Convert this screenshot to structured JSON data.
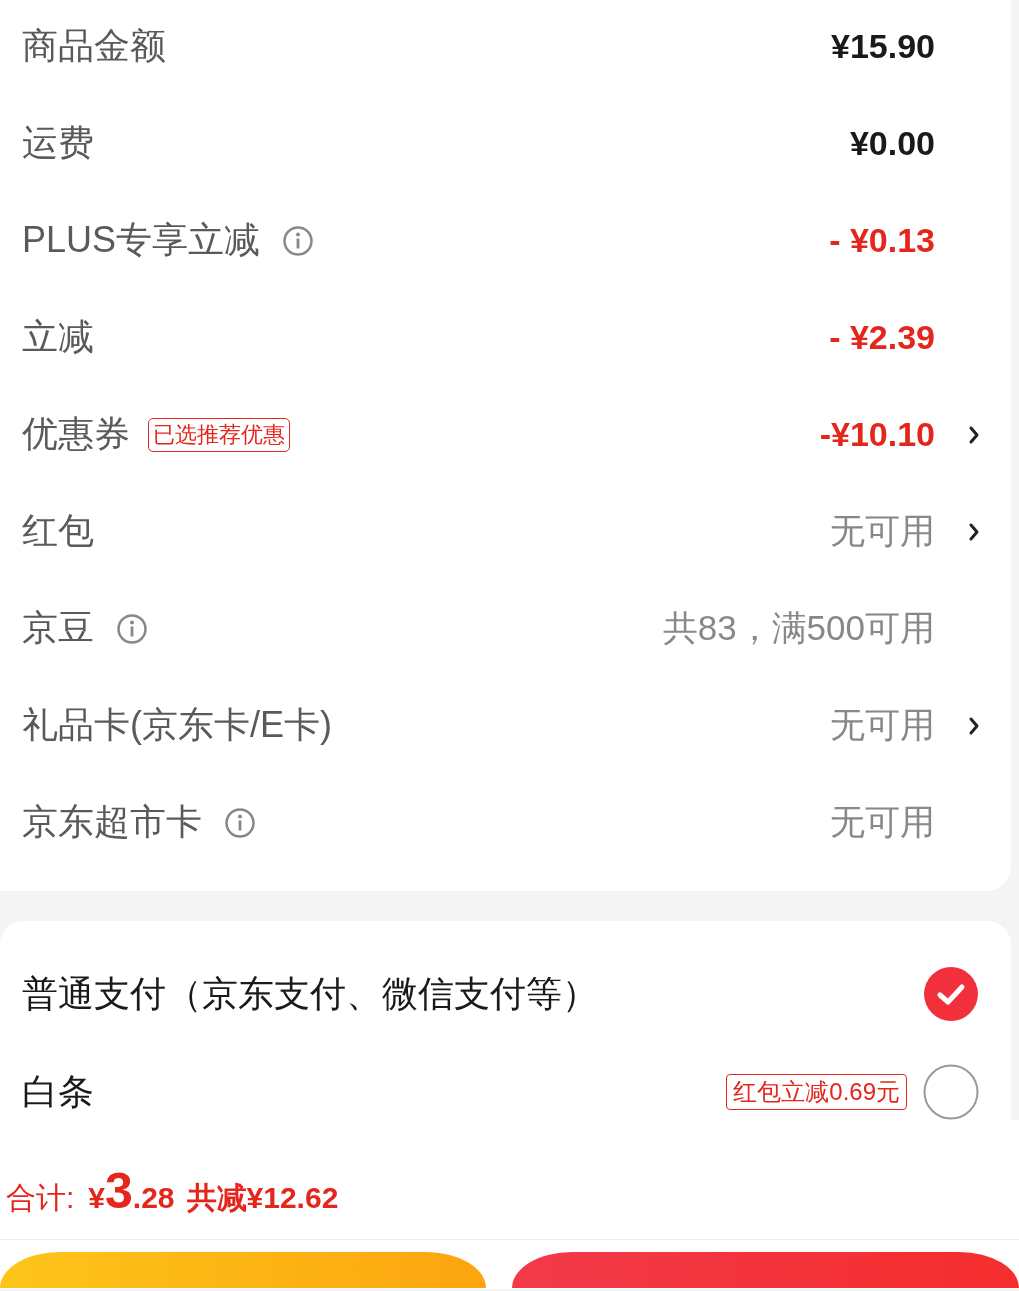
{
  "summary_rows": [
    {
      "label": "商品金额",
      "info": false,
      "value": "¥15.90",
      "kind": "amount",
      "chevron": false
    },
    {
      "label": "运费",
      "info": false,
      "value": "¥0.00",
      "kind": "amount",
      "chevron": false
    },
    {
      "label": "PLUS专享立减",
      "info": true,
      "value": "- ¥0.13",
      "kind": "discount",
      "chevron": false
    },
    {
      "label": "立减",
      "info": false,
      "value": "- ¥2.39",
      "kind": "discount",
      "chevron": false
    },
    {
      "label": "优惠券",
      "info": false,
      "tag": "已选推荐优惠",
      "value": "-¥10.10",
      "kind": "discount",
      "chevron": true
    },
    {
      "label": "红包",
      "info": false,
      "value": "无可用",
      "kind": "muted",
      "chevron": true
    },
    {
      "label": "京豆",
      "info": true,
      "value": "共83，满500可用",
      "kind": "muted",
      "chevron": false
    },
    {
      "label": "礼品卡(京东卡/E卡)",
      "info": false,
      "value": "无可用",
      "kind": "muted",
      "chevron": true
    },
    {
      "label": "京东超市卡",
      "info": true,
      "value": "无可用",
      "kind": "muted",
      "chevron": false
    }
  ],
  "payment_methods": [
    {
      "label": "普通支付（京东支付、微信支付等）",
      "selected": true
    },
    {
      "label": "白条",
      "tag": "红包立减0.69元",
      "selected": false
    }
  ],
  "footer": {
    "total_label": "合计:",
    "currency": "¥",
    "integer": "3",
    "decimal": ".28",
    "saving": "共减¥12.62"
  },
  "buttons": [
    {
      "kind": "secondary"
    },
    {
      "kind": "primary"
    }
  ]
}
